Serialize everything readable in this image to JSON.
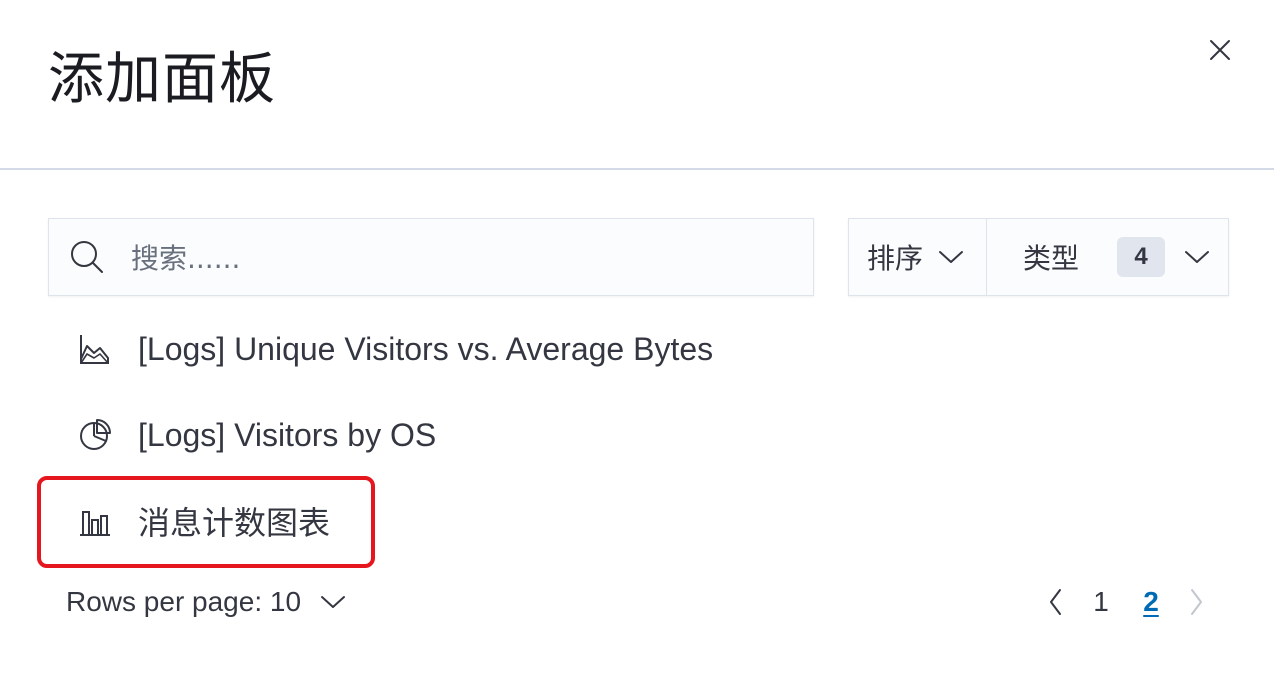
{
  "flyout": {
    "title": "添加面板"
  },
  "search": {
    "placeholder": "搜索......"
  },
  "filters": {
    "sort_label": "排序",
    "type_label": "类型",
    "type_count": "4"
  },
  "list": {
    "items": [
      {
        "label": "[Logs] Unique Visitors vs. Average Bytes",
        "icon": "area-chart-icon"
      },
      {
        "label": "[Logs] Visitors by OS",
        "icon": "pie-chart-icon"
      },
      {
        "label": "消息计数图表",
        "icon": "bar-chart-icon"
      }
    ]
  },
  "pagination": {
    "rows_per_page": "Rows per page: 10",
    "pages": [
      "1",
      "2"
    ],
    "current_page": "2"
  },
  "colors": {
    "accent": "#006bb4",
    "highlight": "#e5161e",
    "border": "#d3dae6",
    "text": "#343741"
  }
}
